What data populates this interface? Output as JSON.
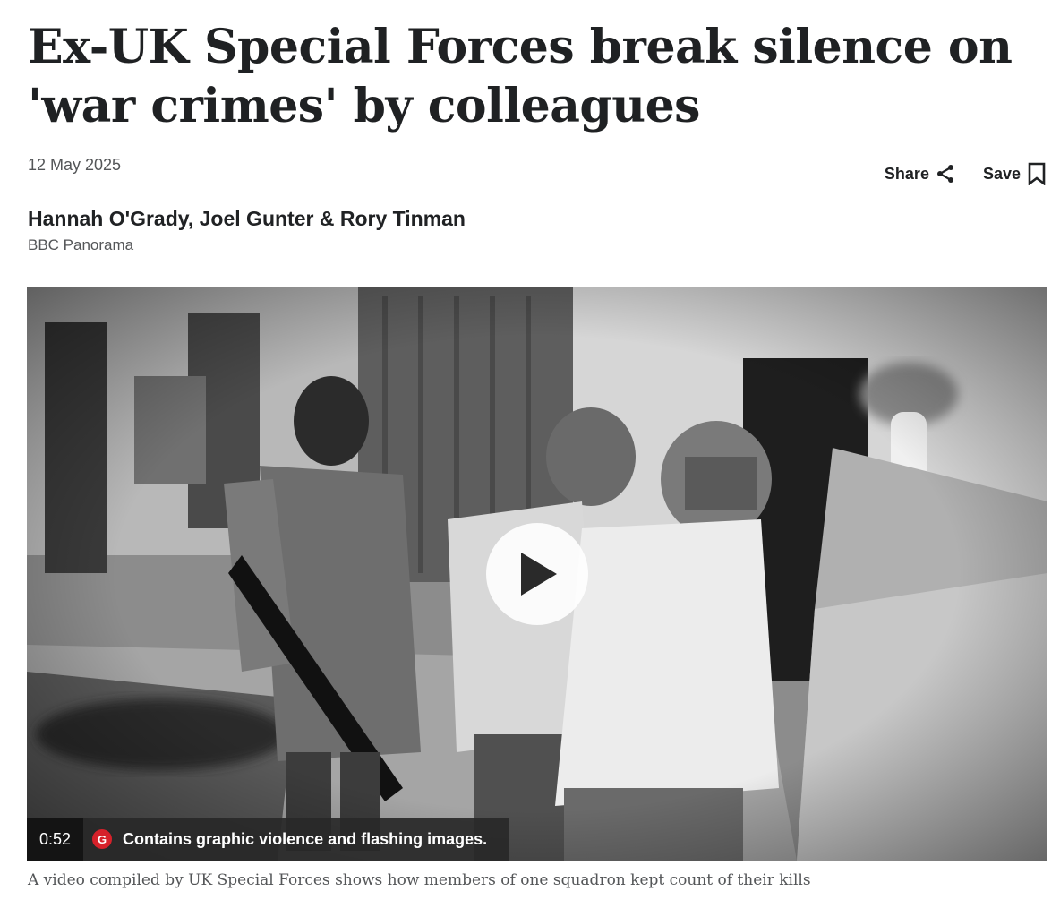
{
  "article": {
    "headline": "Ex-UK Special Forces break silence on 'war crimes' by colleagues",
    "date": "12 May 2025",
    "authors": "Hannah O'Grady, Joel Gunter & Rory Tinman",
    "source": "BBC Panorama"
  },
  "actions": {
    "share_label": "Share",
    "save_label": "Save"
  },
  "video": {
    "duration": "0:52",
    "warning_badge": "G",
    "warning_text": "Contains graphic violence and flashing images.",
    "caption": "A video compiled by UK Special Forces shows how members of one squadron kept count of their kills"
  },
  "icons": {
    "share": "share-icon",
    "save": "bookmark-icon",
    "play": "play-icon"
  },
  "colors": {
    "text": "#202224",
    "muted": "#545658",
    "warning_red": "#d6212a"
  }
}
